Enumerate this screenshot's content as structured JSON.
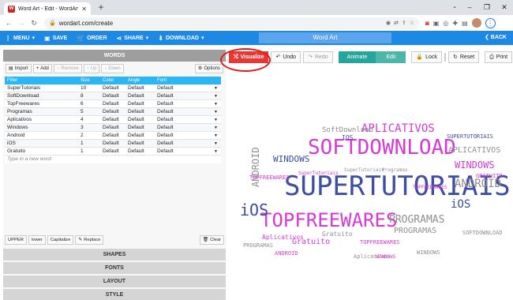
{
  "browser": {
    "tab_title": "Word Art - Edit - WordArt.com",
    "url": "wordart.com/create"
  },
  "appbar": {
    "menu": "MENU",
    "save": "SAVE",
    "order": "ORDER",
    "share": "SHARE",
    "download": "DOWNLOAD",
    "title": "Word Art",
    "back": "BACK"
  },
  "words": {
    "header": "WORDS",
    "tools": {
      "import": "Import",
      "add": "Add",
      "remove": "Remove",
      "up": "Up",
      "down": "Down",
      "options": "Options"
    },
    "columns": {
      "filter": "Filter",
      "size": "Size",
      "color": "Color",
      "angle": "Angle",
      "font": "Font"
    },
    "rows": [
      {
        "word": "SuperTutoriais",
        "size": "10",
        "color": "Default",
        "angle": "Default",
        "font": "Default"
      },
      {
        "word": "SoftDownload",
        "size": "8",
        "color": "Default",
        "angle": "Default",
        "font": "Default"
      },
      {
        "word": "TopFreewares",
        "size": "6",
        "color": "Default",
        "angle": "Default",
        "font": "Default"
      },
      {
        "word": "Programas",
        "size": "5",
        "color": "Default",
        "angle": "Default",
        "font": "Default"
      },
      {
        "word": "Aplicativos",
        "size": "4",
        "color": "Default",
        "angle": "Default",
        "font": "Default"
      },
      {
        "word": "Windows",
        "size": "3",
        "color": "Default",
        "angle": "Default",
        "font": "Default"
      },
      {
        "word": "Android",
        "size": "2",
        "color": "Default",
        "angle": "Default",
        "font": "Default"
      },
      {
        "word": "iOS",
        "size": "1",
        "color": "Default",
        "angle": "Default",
        "font": "Default"
      },
      {
        "word": "Gratuito",
        "size": "1",
        "color": "Default",
        "angle": "Default",
        "font": "Default"
      }
    ],
    "new_word_placeholder": "Type in a new word",
    "case": {
      "upper": "UPPER",
      "lower": "lower",
      "capitalize": "Capitalize",
      "replace": "Replace",
      "clear": "Clear"
    }
  },
  "sections": {
    "shapes": "SHAPES",
    "fonts": "FONTS",
    "layout": "LAYOUT",
    "style": "STYLE"
  },
  "canvas_toolbar": {
    "visualize": "Visualize",
    "undo": "Undo",
    "redo": "Redo",
    "animate": "Animate",
    "edit": "Edit",
    "lock": "Lock",
    "reset": "Reset",
    "print": "Print"
  },
  "colors": {
    "accent": "#1e88e5",
    "visualize": "#e53935",
    "teal": "#26a69a",
    "grid_head": "#29b6f6",
    "cloud_dark": "#3d4ea3",
    "cloud_pink": "#d63ad6",
    "cloud_grey": "#8f8f8f"
  }
}
